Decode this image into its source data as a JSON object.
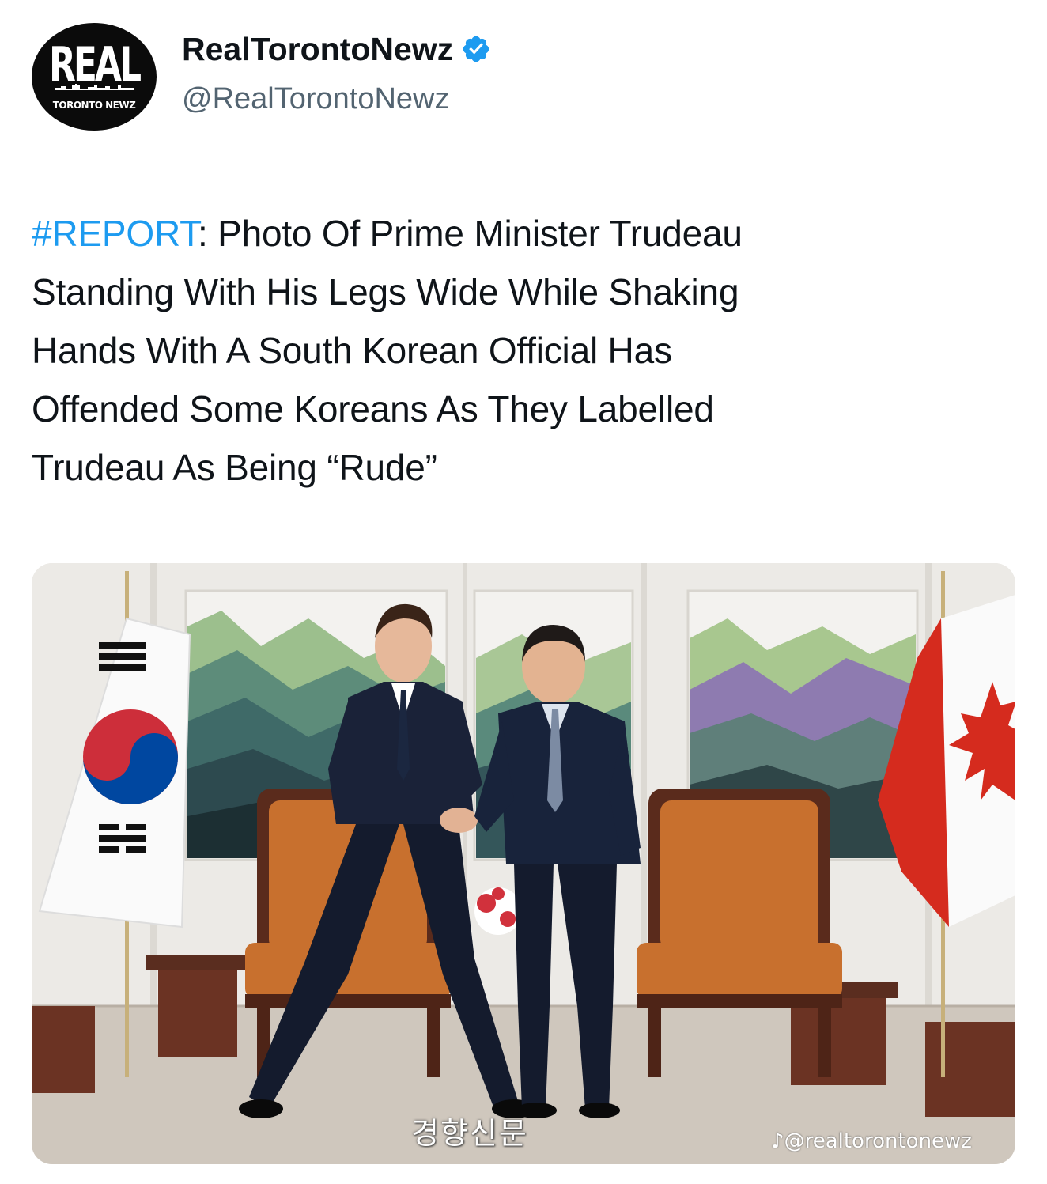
{
  "account": {
    "logo_main": "REAL",
    "logo_sub": "TORONTO NEWZ",
    "name": "RealTorontoNewz",
    "handle": "@RealTorontoNewz",
    "verified_color": "#1d9bf0"
  },
  "post": {
    "hashtag": "#REPORT",
    "line1_rest": ": Photo Of Prime Minister Trudeau",
    "line2": "Standing With His Legs Wide While Shaking",
    "line3": "Hands With A South Korean Official Has",
    "line4": "Offended Some Koreans As They Labelled",
    "line5": "Trudeau As Being “Rude”",
    "hashtag_color": "#1d9bf0"
  },
  "media": {
    "caption": "경향신문",
    "watermark": "♪@realtorontonewz",
    "description_icons": [
      "south-korea-flag",
      "canada-flag"
    ]
  }
}
